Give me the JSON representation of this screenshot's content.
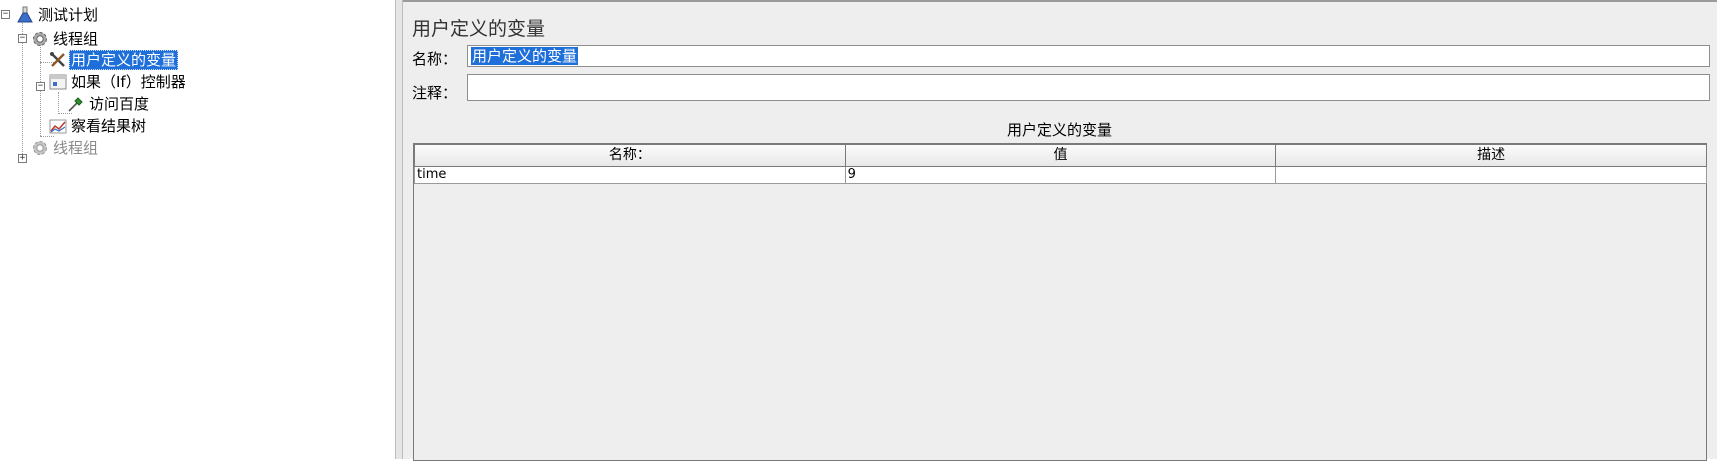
{
  "tree": {
    "items": [
      {
        "label": "测试计划",
        "icon": "beaker-icon",
        "state": "normal"
      },
      {
        "label": "线程组",
        "icon": "gear-icon",
        "state": "normal"
      },
      {
        "label": "用户定义的变量",
        "icon": "wrench-screwdriver-icon",
        "state": "selected"
      },
      {
        "label": "如果（If）控制器",
        "icon": "controller-icon",
        "state": "normal"
      },
      {
        "label": "访问百度",
        "icon": "pipette-icon",
        "state": "normal"
      },
      {
        "label": "察看结果树",
        "icon": "chart-icon",
        "state": "normal"
      },
      {
        "label": "线程组",
        "icon": "gear-icon",
        "state": "disabled"
      }
    ]
  },
  "panel": {
    "title": "用户定义的变量",
    "name_label": "名称：",
    "name_value": "用户定义的变量",
    "comment_label": "注释：",
    "comment_value": "",
    "table": {
      "caption": "用户定义的变量",
      "columns": [
        "名称：",
        "值",
        "描述"
      ],
      "rows": [
        [
          "time",
          "9",
          ""
        ]
      ]
    }
  }
}
